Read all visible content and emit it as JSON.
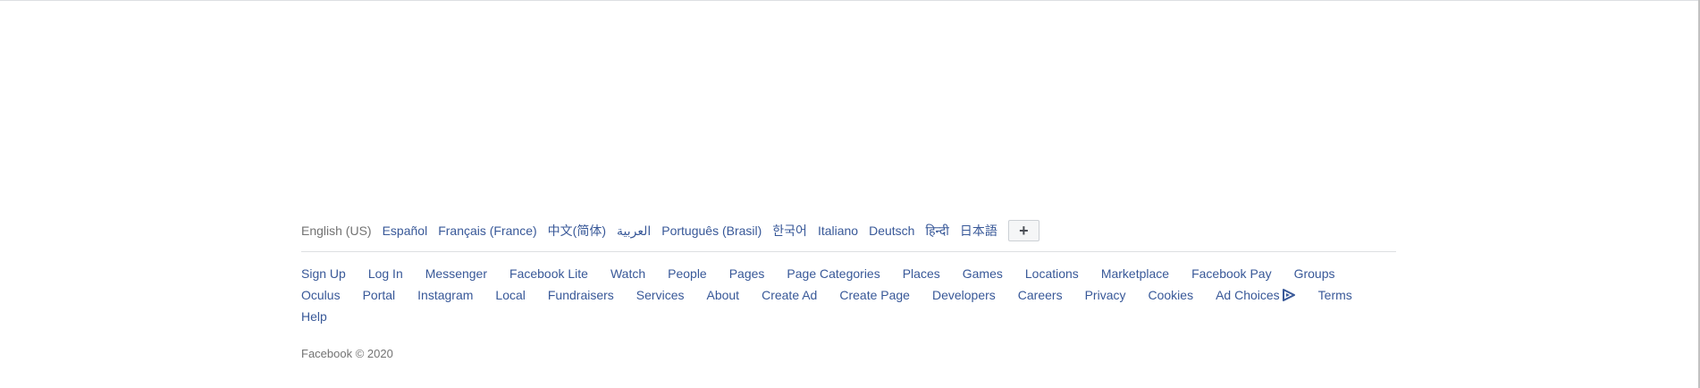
{
  "languages": {
    "current": "English (US)",
    "items": [
      "Español",
      "Français (France)",
      "中文(简体)",
      "العربية",
      "Português (Brasil)",
      "한국어",
      "Italiano",
      "Deutsch",
      "हिन्दी",
      "日本語"
    ],
    "more_label": "+"
  },
  "links": [
    "Sign Up",
    "Log In",
    "Messenger",
    "Facebook Lite",
    "Watch",
    "People",
    "Pages",
    "Page Categories",
    "Places",
    "Games",
    "Locations",
    "Marketplace",
    "Facebook Pay",
    "Groups",
    "Oculus",
    "Portal",
    "Instagram",
    "Local",
    "Fundraisers",
    "Services",
    "About",
    "Create Ad",
    "Create Page",
    "Developers",
    "Careers",
    "Privacy",
    "Cookies",
    "Ad Choices",
    "Terms",
    "Help"
  ],
  "adchoices_icon": "adchoices-icon",
  "copyright": "Facebook © 2020",
  "colors": {
    "link": "#385898",
    "muted": "#737373",
    "divider": "#dddfe2"
  }
}
